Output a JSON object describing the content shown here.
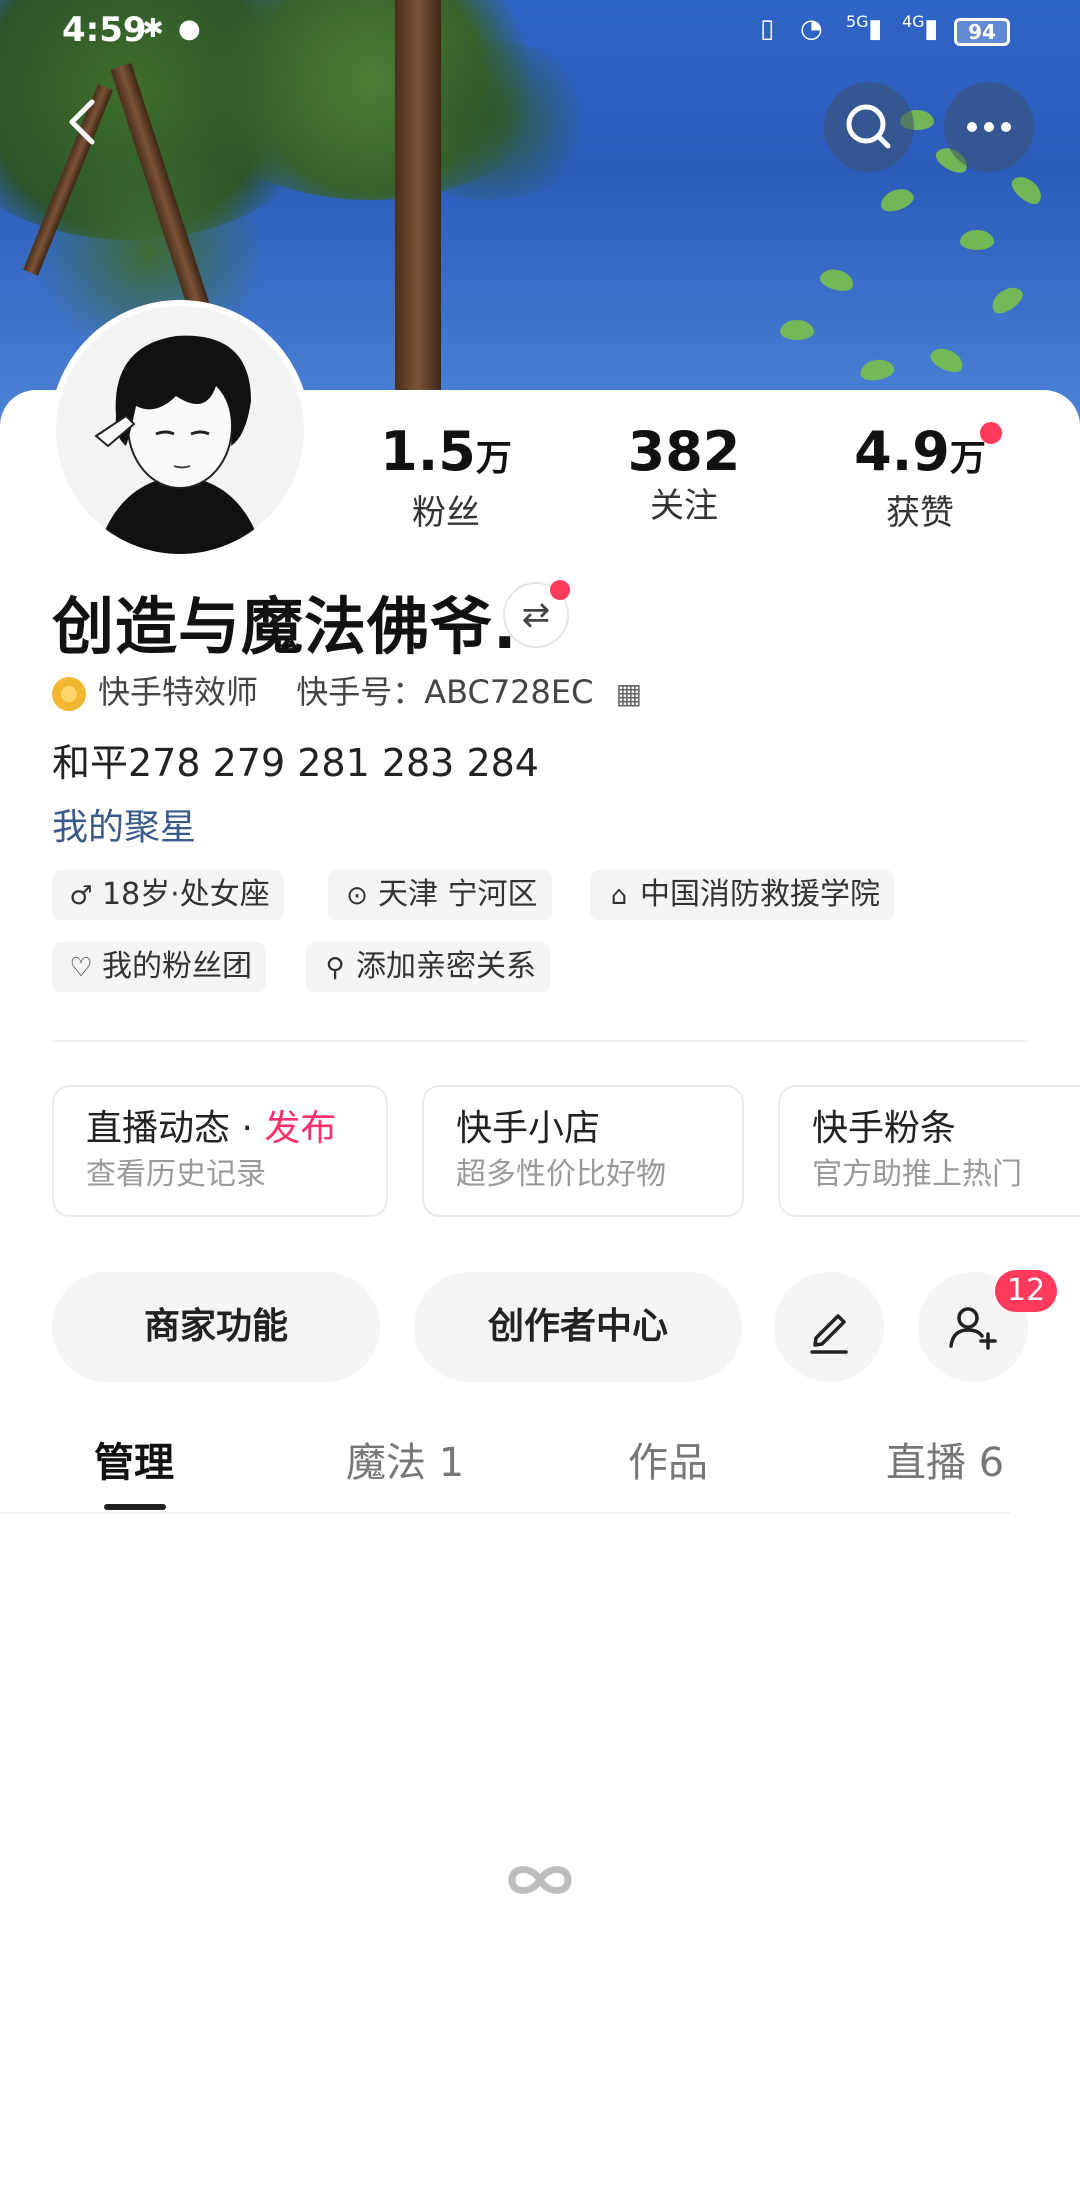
{
  "status_bar": {
    "time": "4:59",
    "battery": "94",
    "net1": "5G",
    "net2": "4G"
  },
  "profile": {
    "name": "创造与魔法佛爷.",
    "badge": "快手特效师",
    "id_text": "快手号：ABC728EC",
    "bio": "和平278 279 281 283 284",
    "link": "我的聚星"
  },
  "stats": [
    {
      "num": "1.5",
      "unit": "万",
      "label": "粉丝"
    },
    {
      "num": "382",
      "unit": "",
      "label": "关注"
    },
    {
      "num": "4.9",
      "unit": "万",
      "label": "获赞"
    }
  ],
  "tags": [
    {
      "icon": "male-icon",
      "text": "18岁·处女座"
    },
    {
      "icon": "location-icon",
      "text": "天津 宁河区"
    },
    {
      "icon": "school-icon",
      "text": "中国消防救援学院"
    },
    {
      "icon": "heart-icon",
      "text": "我的粉丝团"
    },
    {
      "icon": "add-person-icon",
      "text": "添加亲密关系"
    }
  ],
  "services": [
    {
      "title": "直播动态",
      "sep": " · ",
      "accent": "发布",
      "subtitle": "查看历史记录"
    },
    {
      "title": "快手小店",
      "subtitle": "超多性价比好物"
    },
    {
      "title": "快手粉条",
      "subtitle": "官方助推上热门"
    }
  ],
  "actions": {
    "merchant": "商家功能",
    "creator": "创作者中心",
    "friend_badge": "12"
  },
  "tabs": [
    {
      "label": "管理",
      "active": true
    },
    {
      "label": "魔法 1"
    },
    {
      "label": "作品"
    },
    {
      "label": "直播 6"
    }
  ],
  "colors": {
    "accent": "#ff2f6a",
    "red_dot": "#ff3a5c",
    "link": "#3a5a8c"
  }
}
